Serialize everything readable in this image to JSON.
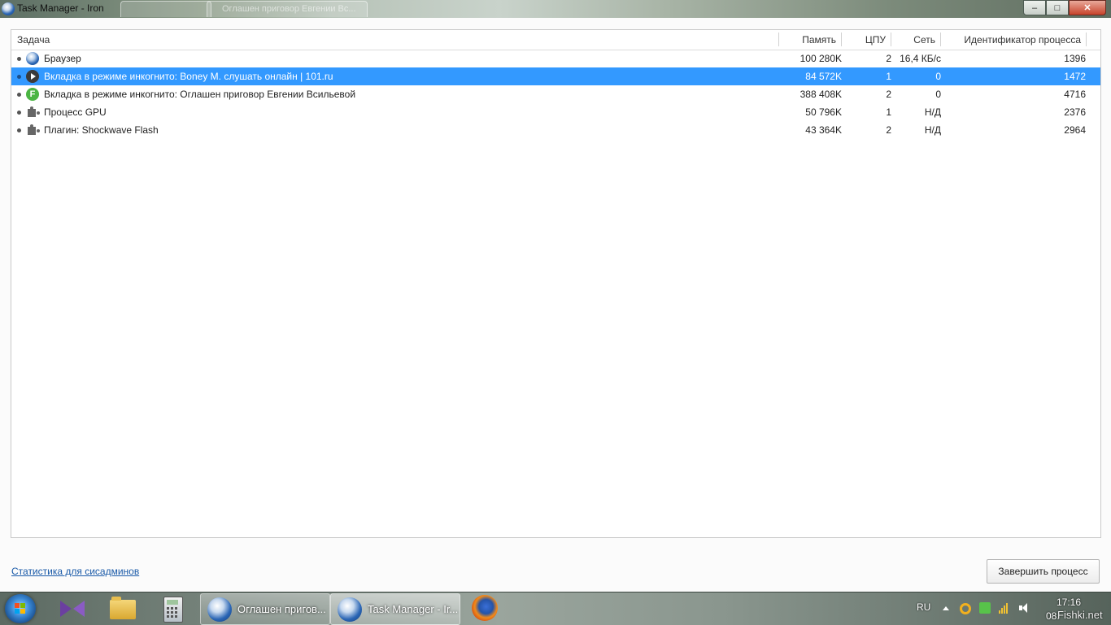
{
  "window": {
    "title": "Task Manager - Iron",
    "bg_tabs": [
      "",
      "Оглашен приговор Евгении Вс..."
    ],
    "controls": {
      "minimize": "–",
      "maximize": "□",
      "close": "✕"
    }
  },
  "table": {
    "columns": {
      "task": "Задача",
      "memory": "Память",
      "cpu": "ЦПУ",
      "network": "Сеть",
      "pid": "Идентификатор процесса"
    },
    "rows": [
      {
        "icon": "browser-globe-icon",
        "name": "Браузер",
        "memory": "100 280K",
        "cpu": "2",
        "network": "16,4 КБ/с",
        "pid": "1396",
        "selected": false
      },
      {
        "icon": "play-icon",
        "name": "Вкладка в режиме инкогнито: Boney M. слушать онлайн | 101.ru",
        "memory": "84 572K",
        "cpu": "1",
        "network": "0",
        "pid": "1472",
        "selected": true
      },
      {
        "icon": "f-letter-icon",
        "name": "Вкладка в режиме инкогнито: Оглашен приговор Евгении Всильевой",
        "memory": "388 408K",
        "cpu": "2",
        "network": "0",
        "pid": "4716",
        "selected": false
      },
      {
        "icon": "puzzle-icon",
        "name": "Процесс GPU",
        "memory": "50 796K",
        "cpu": "1",
        "network": "Н/Д",
        "pid": "2376",
        "selected": false
      },
      {
        "icon": "puzzle-icon",
        "name": "Плагин: Shockwave Flash",
        "memory": "43 364K",
        "cpu": "2",
        "network": "Н/Д",
        "pid": "2964",
        "selected": false
      }
    ]
  },
  "footer": {
    "stats_link": "Статистика для сисадминов",
    "end_process": "Завершить процесс"
  },
  "taskbar": {
    "buttons": [
      {
        "label": "Оглашен пригов...",
        "active": false
      },
      {
        "label": "Task Manager - Ir...",
        "active": true
      }
    ],
    "tray": {
      "language": "RU",
      "time": "17:16",
      "date": "08.",
      "watermark": "Fishki.net"
    }
  },
  "colors": {
    "selection": "#3399ff",
    "link": "#1a5aa8"
  }
}
